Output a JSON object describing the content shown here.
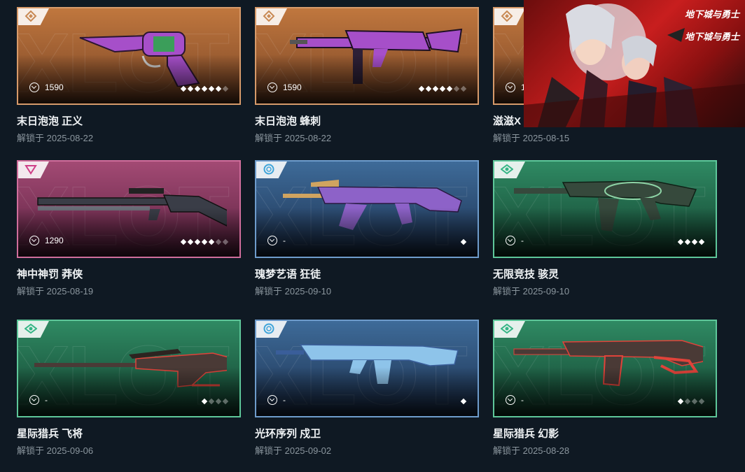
{
  "currency_icon": "vp-icon",
  "unlock_prefix": "解锁于",
  "skins": [
    {
      "name": "末日泡泡 正义",
      "price": "1590",
      "date": "2025-08-22",
      "tier": "deluxe",
      "rarity": 6,
      "rarity_max": 7,
      "bg1": "#c0773e",
      "bg2": "#7a4526",
      "border": "#d79a6a",
      "tier_color": "#c98a55",
      "gun": "#a64fc9",
      "gun2": "#3b9e5a",
      "kind": "pistol"
    },
    {
      "name": "末日泡泡 蜂刺",
      "price": "1590",
      "date": "2025-08-22",
      "tier": "deluxe",
      "rarity": 5,
      "rarity_max": 7,
      "bg1": "#c0773e",
      "bg2": "#7a4526",
      "border": "#d79a6a",
      "tier_color": "#c98a55",
      "gun": "#a64fc9",
      "gun2": "#2d2036",
      "kind": "smg"
    },
    {
      "name": "滋滋X",
      "price": "1",
      "date": "2025-08-15",
      "tier": "deluxe",
      "rarity": 0,
      "rarity_max": 0,
      "bg1": "#c0773e",
      "bg2": "#7a4526",
      "border": "#d79a6a",
      "tier_color": "#c98a55",
      "gun": "#555",
      "gun2": "#333",
      "kind": "none"
    },
    {
      "name": "神中神罚 莽侠",
      "price": "1290",
      "date": "2025-08-19",
      "tier": "premium",
      "rarity": 5,
      "rarity_max": 7,
      "bg1": "#a34a74",
      "bg2": "#5a2140",
      "border": "#d06e9c",
      "tier_color": "#cf3f87",
      "gun": "#3a3d47",
      "gun2": "#6a6e78",
      "kind": "shotgun"
    },
    {
      "name": "瑰梦艺语 狂徒",
      "price": "-",
      "date": "2025-09-10",
      "tier": "select",
      "rarity": 1,
      "rarity_max": 1,
      "bg1": "#3e6b99",
      "bg2": "#1c3150",
      "border": "#6e9ccc",
      "tier_color": "#3fa4d9",
      "gun": "#8d62c8",
      "gun2": "#d0a460",
      "kind": "rifle"
    },
    {
      "name": "无限竞技 骇灵",
      "price": "-",
      "date": "2025-09-10",
      "tier": "exclusive",
      "rarity": 4,
      "rarity_max": 4,
      "bg1": "#2f8a63",
      "bg2": "#13412f",
      "border": "#5ec79a",
      "tier_color": "#35b585",
      "gun": "#36493c",
      "gun2": "#8ed4a6",
      "kind": "smg2"
    },
    {
      "name": "星际猎兵 飞将",
      "price": "-",
      "date": "2025-09-06",
      "tier": "exclusive",
      "rarity": 1,
      "rarity_max": 4,
      "bg1": "#2f8a63",
      "bg2": "#13412f",
      "border": "#5ec79a",
      "tier_color": "#35b585",
      "gun": "#4a3a36",
      "gun2": "#e0433a",
      "kind": "sniper"
    },
    {
      "name": "光环序列 戍卫",
      "price": "-",
      "date": "2025-09-02",
      "tier": "select",
      "rarity": 1,
      "rarity_max": 1,
      "bg1": "#3e6b99",
      "bg2": "#1c3150",
      "border": "#6e9ccc",
      "tier_color": "#3fa4d9",
      "gun": "#8ec4ea",
      "gun2": "#3a5e9a",
      "kind": "rifle2"
    },
    {
      "name": "星际猎兵 幻影",
      "price": "-",
      "date": "2025-08-28",
      "tier": "exclusive",
      "rarity": 1,
      "rarity_max": 4,
      "bg1": "#2f8a63",
      "bg2": "#13412f",
      "border": "#5ec79a",
      "tier_color": "#35b585",
      "gun": "#4a3a36",
      "gun2": "#e0433a",
      "kind": "rifle3"
    }
  ],
  "watermark": "XLOT",
  "ad": {
    "logo_top": "地下城与勇士",
    "logo_bottom": "地下城与勇士",
    "label": "ad-banner"
  }
}
